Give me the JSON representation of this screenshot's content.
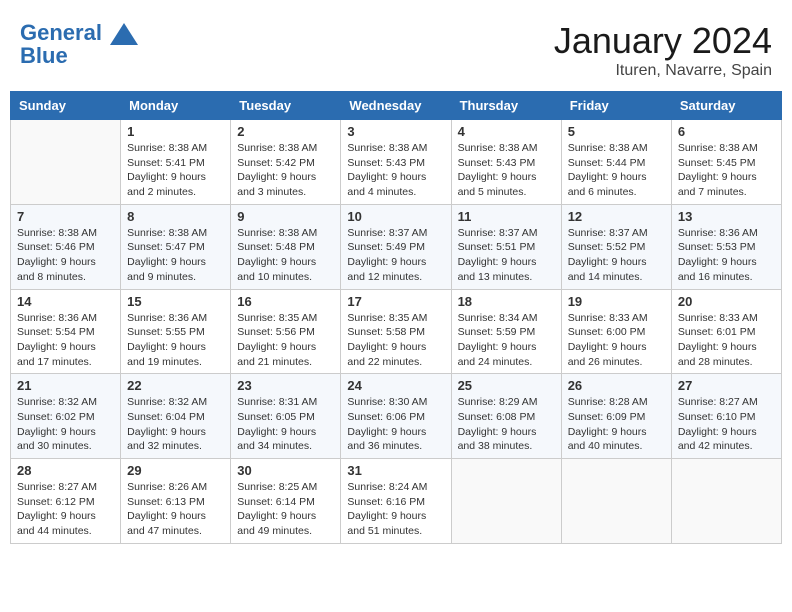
{
  "header": {
    "logo_line1": "General",
    "logo_line2": "Blue",
    "month": "January 2024",
    "location": "Ituren, Navarre, Spain"
  },
  "weekdays": [
    "Sunday",
    "Monday",
    "Tuesday",
    "Wednesday",
    "Thursday",
    "Friday",
    "Saturday"
  ],
  "weeks": [
    [
      {
        "day": "",
        "info": ""
      },
      {
        "day": "1",
        "info": "Sunrise: 8:38 AM\nSunset: 5:41 PM\nDaylight: 9 hours\nand 2 minutes."
      },
      {
        "day": "2",
        "info": "Sunrise: 8:38 AM\nSunset: 5:42 PM\nDaylight: 9 hours\nand 3 minutes."
      },
      {
        "day": "3",
        "info": "Sunrise: 8:38 AM\nSunset: 5:43 PM\nDaylight: 9 hours\nand 4 minutes."
      },
      {
        "day": "4",
        "info": "Sunrise: 8:38 AM\nSunset: 5:43 PM\nDaylight: 9 hours\nand 5 minutes."
      },
      {
        "day": "5",
        "info": "Sunrise: 8:38 AM\nSunset: 5:44 PM\nDaylight: 9 hours\nand 6 minutes."
      },
      {
        "day": "6",
        "info": "Sunrise: 8:38 AM\nSunset: 5:45 PM\nDaylight: 9 hours\nand 7 minutes."
      }
    ],
    [
      {
        "day": "7",
        "info": "Sunrise: 8:38 AM\nSunset: 5:46 PM\nDaylight: 9 hours\nand 8 minutes."
      },
      {
        "day": "8",
        "info": "Sunrise: 8:38 AM\nSunset: 5:47 PM\nDaylight: 9 hours\nand 9 minutes."
      },
      {
        "day": "9",
        "info": "Sunrise: 8:38 AM\nSunset: 5:48 PM\nDaylight: 9 hours\nand 10 minutes."
      },
      {
        "day": "10",
        "info": "Sunrise: 8:37 AM\nSunset: 5:49 PM\nDaylight: 9 hours\nand 12 minutes."
      },
      {
        "day": "11",
        "info": "Sunrise: 8:37 AM\nSunset: 5:51 PM\nDaylight: 9 hours\nand 13 minutes."
      },
      {
        "day": "12",
        "info": "Sunrise: 8:37 AM\nSunset: 5:52 PM\nDaylight: 9 hours\nand 14 minutes."
      },
      {
        "day": "13",
        "info": "Sunrise: 8:36 AM\nSunset: 5:53 PM\nDaylight: 9 hours\nand 16 minutes."
      }
    ],
    [
      {
        "day": "14",
        "info": "Sunrise: 8:36 AM\nSunset: 5:54 PM\nDaylight: 9 hours\nand 17 minutes."
      },
      {
        "day": "15",
        "info": "Sunrise: 8:36 AM\nSunset: 5:55 PM\nDaylight: 9 hours\nand 19 minutes."
      },
      {
        "day": "16",
        "info": "Sunrise: 8:35 AM\nSunset: 5:56 PM\nDaylight: 9 hours\nand 21 minutes."
      },
      {
        "day": "17",
        "info": "Sunrise: 8:35 AM\nSunset: 5:58 PM\nDaylight: 9 hours\nand 22 minutes."
      },
      {
        "day": "18",
        "info": "Sunrise: 8:34 AM\nSunset: 5:59 PM\nDaylight: 9 hours\nand 24 minutes."
      },
      {
        "day": "19",
        "info": "Sunrise: 8:33 AM\nSunset: 6:00 PM\nDaylight: 9 hours\nand 26 minutes."
      },
      {
        "day": "20",
        "info": "Sunrise: 8:33 AM\nSunset: 6:01 PM\nDaylight: 9 hours\nand 28 minutes."
      }
    ],
    [
      {
        "day": "21",
        "info": "Sunrise: 8:32 AM\nSunset: 6:02 PM\nDaylight: 9 hours\nand 30 minutes."
      },
      {
        "day": "22",
        "info": "Sunrise: 8:32 AM\nSunset: 6:04 PM\nDaylight: 9 hours\nand 32 minutes."
      },
      {
        "day": "23",
        "info": "Sunrise: 8:31 AM\nSunset: 6:05 PM\nDaylight: 9 hours\nand 34 minutes."
      },
      {
        "day": "24",
        "info": "Sunrise: 8:30 AM\nSunset: 6:06 PM\nDaylight: 9 hours\nand 36 minutes."
      },
      {
        "day": "25",
        "info": "Sunrise: 8:29 AM\nSunset: 6:08 PM\nDaylight: 9 hours\nand 38 minutes."
      },
      {
        "day": "26",
        "info": "Sunrise: 8:28 AM\nSunset: 6:09 PM\nDaylight: 9 hours\nand 40 minutes."
      },
      {
        "day": "27",
        "info": "Sunrise: 8:27 AM\nSunset: 6:10 PM\nDaylight: 9 hours\nand 42 minutes."
      }
    ],
    [
      {
        "day": "28",
        "info": "Sunrise: 8:27 AM\nSunset: 6:12 PM\nDaylight: 9 hours\nand 44 minutes."
      },
      {
        "day": "29",
        "info": "Sunrise: 8:26 AM\nSunset: 6:13 PM\nDaylight: 9 hours\nand 47 minutes."
      },
      {
        "day": "30",
        "info": "Sunrise: 8:25 AM\nSunset: 6:14 PM\nDaylight: 9 hours\nand 49 minutes."
      },
      {
        "day": "31",
        "info": "Sunrise: 8:24 AM\nSunset: 6:16 PM\nDaylight: 9 hours\nand 51 minutes."
      },
      {
        "day": "",
        "info": ""
      },
      {
        "day": "",
        "info": ""
      },
      {
        "day": "",
        "info": ""
      }
    ]
  ]
}
